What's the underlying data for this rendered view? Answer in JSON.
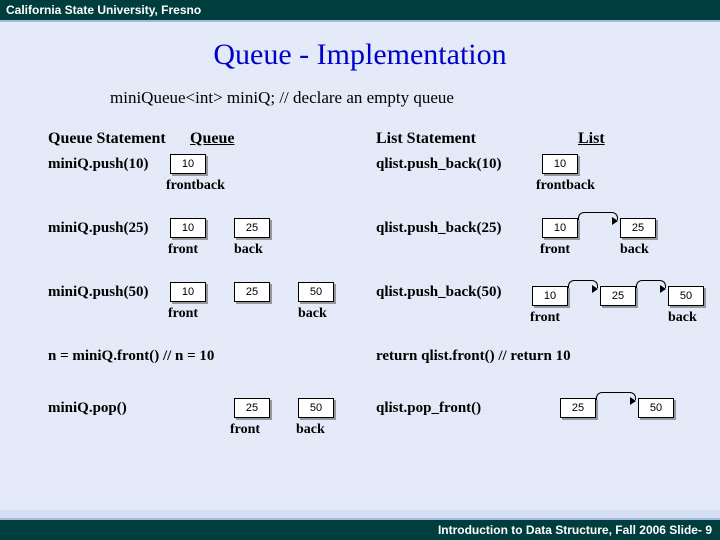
{
  "header": {
    "institution": "California State University, Fresno"
  },
  "title": "Queue - Implementation",
  "declaration": "miniQueue<int> miniQ;   // declare an empty queue",
  "columns": {
    "queue_stmt": "Queue Statement",
    "queue": "Queue",
    "list_stmt": "List Statement",
    "list": "List"
  },
  "queue_ops": {
    "push10": "miniQ.push(10)",
    "push25": "miniQ.push(25)",
    "push50": "miniQ.push(50)",
    "front": "n = miniQ.front()   // n = 10",
    "pop": "miniQ.pop()"
  },
  "list_ops": {
    "push10": "qlist.push_back(10)",
    "push25": "qlist.push_back(25)",
    "push50": "qlist.push_back(50)",
    "front": "return qlist.front()       // return 10",
    "pop": "qlist.pop_front()"
  },
  "values": {
    "v10": "10",
    "v25": "25",
    "v50": "50"
  },
  "labels": {
    "front": "front",
    "back": "back",
    "frontback": "frontback"
  },
  "footer": "Introduction to Data Structure, Fall 2006  Slide- 9"
}
